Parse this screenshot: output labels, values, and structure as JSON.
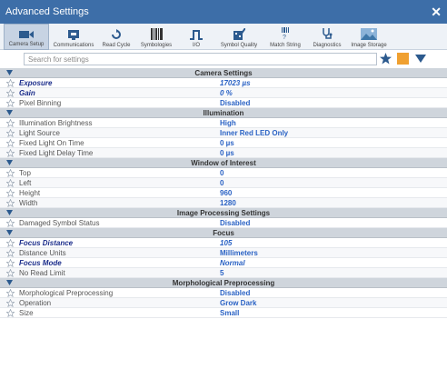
{
  "window": {
    "title": "Advanced Settings"
  },
  "toolbar": {
    "tools": [
      {
        "label": "Camera Setup",
        "icon": "camera-icon",
        "active": true
      },
      {
        "label": "Communications",
        "icon": "communications-icon"
      },
      {
        "label": "Read Cycle",
        "icon": "read-cycle-icon"
      },
      {
        "label": "Symbologies",
        "icon": "barcode-icon"
      },
      {
        "label": "I/O",
        "icon": "io-signal-icon"
      },
      {
        "label": "Symbol Quality",
        "icon": "symbol-quality-icon"
      },
      {
        "label": "Match String",
        "icon": "match-string-icon"
      },
      {
        "label": "Diagnostics",
        "icon": "stethoscope-icon"
      },
      {
        "label": "Image Storage",
        "icon": "image-storage-icon"
      }
    ]
  },
  "search": {
    "placeholder": "Search for settings"
  },
  "colors": {
    "titlebar": "#3d6ea8",
    "value": "#2a62c4",
    "modified_name": "#1a2c8a",
    "section": "#cfd5dc",
    "accent_square": "#f0a030",
    "icon_blue": "#2c5a8e"
  },
  "sections": [
    {
      "title": "Camera Settings",
      "rows": [
        {
          "name": "Exposure",
          "value": "17023 µs",
          "modified": true
        },
        {
          "name": "Gain",
          "value": "0 %",
          "modified": true
        },
        {
          "name": "Pixel Binning",
          "value": "Disabled",
          "modified": false
        }
      ]
    },
    {
      "title": "Illumination",
      "rows": [
        {
          "name": "Illumination Brightness",
          "value": "High",
          "modified": false
        },
        {
          "name": "Light Source",
          "value": "Inner Red LED Only",
          "modified": false
        },
        {
          "name": "Fixed Light On Time",
          "value": "0 µs",
          "modified": false
        },
        {
          "name": "Fixed Light Delay Time",
          "value": "0 µs",
          "modified": false
        }
      ]
    },
    {
      "title": "Window of Interest",
      "rows": [
        {
          "name": "Top",
          "value": "0",
          "modified": false
        },
        {
          "name": "Left",
          "value": "0",
          "modified": false
        },
        {
          "name": "Height",
          "value": "960",
          "modified": false
        },
        {
          "name": "Width",
          "value": "1280",
          "modified": false
        }
      ]
    },
    {
      "title": "Image Processing Settings",
      "rows": [
        {
          "name": "Damaged Symbol Status",
          "value": "Disabled",
          "modified": false
        }
      ]
    },
    {
      "title": "Focus",
      "rows": [
        {
          "name": "Focus Distance",
          "value": "105",
          "modified": true
        },
        {
          "name": "Distance Units",
          "value": "Millimeters",
          "modified": false
        },
        {
          "name": "Focus Mode",
          "value": "Normal",
          "modified": true
        },
        {
          "name": "No Read Limit",
          "value": "5",
          "modified": false
        }
      ]
    },
    {
      "title": "Morphological Preprocessing",
      "rows": [
        {
          "name": "Morphological Preprocessing",
          "value": "Disabled",
          "modified": false
        },
        {
          "name": "Operation",
          "value": "Grow Dark",
          "modified": false
        },
        {
          "name": "Size",
          "value": "Small",
          "modified": false
        }
      ]
    }
  ]
}
